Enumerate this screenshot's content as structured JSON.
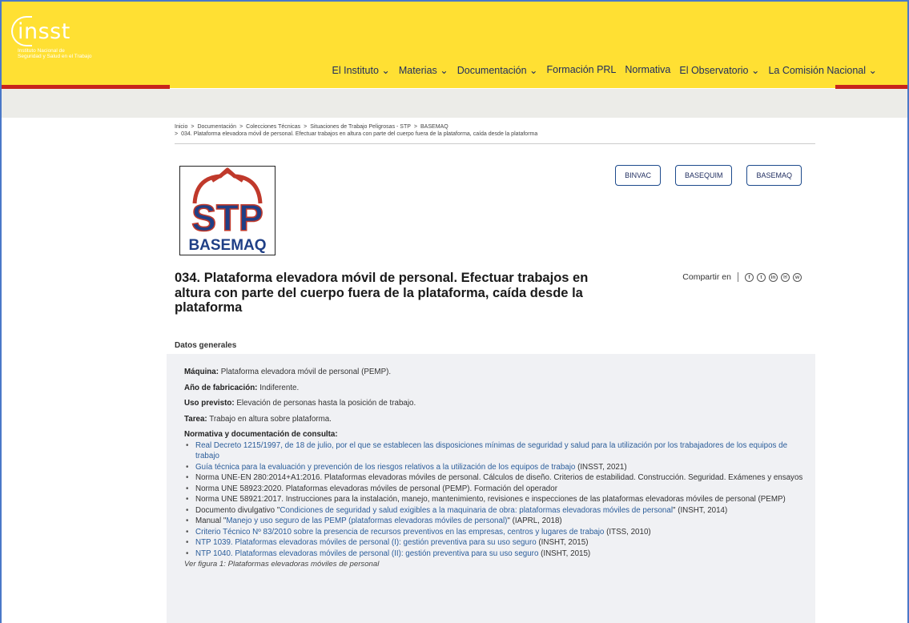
{
  "brand": {
    "name": "insst",
    "subtitle_line1": "Instituto Nacional de",
    "subtitle_line2": "Seguridad y Salud en el Trabajo"
  },
  "nav": [
    {
      "label": "El Instituto ⌄"
    },
    {
      "label": "Materias ⌄"
    },
    {
      "label": "Documentación ⌄"
    },
    {
      "label": "Formación PRL"
    },
    {
      "label": "Normativa"
    },
    {
      "label": "El Observatorio ⌄"
    },
    {
      "label": "La Comisión Nacional ⌄"
    }
  ],
  "breadcrumb": {
    "items": [
      "Inicio",
      "Documentación",
      "Colecciones Técnicas",
      "Situaciones de Trabajo Peligrosas - STP",
      "BASEMAQ"
    ],
    "current": "034. Plataforma elevadora móvil de personal. Efectuar trabajos en altura con parte del cuerpo fuera de la plataforma, caída desde la plataforma"
  },
  "stp_logo": {
    "top": "STP",
    "bottom": "BASEMAQ"
  },
  "top_buttons": [
    "BINVAC",
    "BASEQUIM",
    "BASEMAQ"
  ],
  "title": "034. Plataforma elevadora móvil de personal. Efectuar trabajos en altura con parte del cuerpo fuera de la plataforma, caída desde la plataforma",
  "share": {
    "label": "Compartir en",
    "icons": [
      "f",
      "t",
      "in",
      "✉",
      "w"
    ]
  },
  "section": {
    "title": "Datos generales",
    "fields": [
      {
        "label": "Máquina:",
        "value": "Plataforma elevadora móvil de personal (PEMP)."
      },
      {
        "label": "Año de fabricación:",
        "value": "Indiferente."
      },
      {
        "label": "Uso previsto:",
        "value": "Elevación de personas hasta la posición de trabajo."
      },
      {
        "label": "Tarea:",
        "value": "Trabajo en altura sobre plataforma."
      }
    ],
    "refs_title": "Normativa y documentación de consulta:",
    "refs": [
      {
        "pre": "",
        "link": "Real Decreto 1215/1997, de 18 de julio, por el que se establecen las disposiciones mínimas de seguridad y salud para la utilización por los trabajadores de los equipos de trabajo",
        "post": ""
      },
      {
        "pre": "",
        "link": "Guía técnica para la evaluación y prevención de los riesgos relativos a la utilización de los equipos de trabajo",
        "post": " (INSST, 2021)"
      },
      {
        "pre": "Norma UNE-EN 280:2014+A1:2016. Plataformas elevadoras móviles de personal. Cálculos de diseño. Criterios de estabilidad. Construcción. Seguridad. Exámenes y ensayos",
        "link": "",
        "post": ""
      },
      {
        "pre": "Norma UNE 58923:2020. Plataformas elevadoras móviles de personal (PEMP). Formación del operador",
        "link": "",
        "post": ""
      },
      {
        "pre": "Norma UNE 58921:2017. Instrucciones para la instalación, manejo, mantenimiento, revisiones e inspecciones de las plataformas elevadoras móviles de personal (PEMP)",
        "link": "",
        "post": ""
      },
      {
        "pre": "Documento divulgativo \"",
        "link": "Condiciones de seguridad y salud exigibles a la maquinaria de obra: plataformas elevadoras móviles de personal",
        "post": "\" (INSHT, 2014)"
      },
      {
        "pre": "Manual \"",
        "link": "Manejo y uso seguro de las PEMP (plataformas elevadoras móviles de personal)",
        "post": "\" (IAPRL, 2018)"
      },
      {
        "pre": "",
        "link": "Criterio Técnico Nº 83/2010 sobre la presencia de recursos preventivos en las empresas, centros y lugares de trabajo",
        "post": " (ITSS, 2010)"
      },
      {
        "pre": "",
        "link": "NTP 1039. Plataformas elevadoras móviles de personal (I): gestión preventiva para su uso seguro",
        "post": " (INSHT, 2015)"
      },
      {
        "pre": "",
        "link": "NTP 1040. Plataformas elevadoras móviles de personal (II): gestión preventiva para su uso seguro",
        "post": " (INSHT, 2015)"
      }
    ],
    "figure_note": "Ver figura 1: Plataformas elevadoras móviles de personal"
  }
}
